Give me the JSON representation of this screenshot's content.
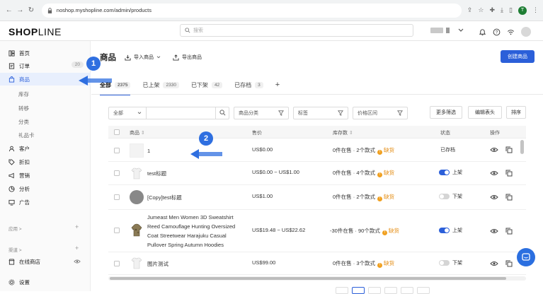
{
  "browser": {
    "url": "noshop.myshopline.com/admin/products",
    "avatar_letter": "T"
  },
  "header": {
    "logo_bold": "SHOP",
    "logo_thin": "LINE",
    "search_placeholder": "搜索"
  },
  "sidebar": {
    "items": [
      {
        "label": "首页",
        "icon": "home-icon"
      },
      {
        "label": "订单",
        "icon": "order-icon",
        "badge": "20"
      },
      {
        "label": "商品",
        "icon": "bag-icon"
      },
      {
        "label": "客户",
        "icon": "user-icon"
      },
      {
        "label": "折扣",
        "icon": "tag-icon"
      },
      {
        "label": "营销",
        "icon": "megaphone-icon"
      },
      {
        "label": "分析",
        "icon": "chart-icon"
      },
      {
        "label": "广告",
        "icon": "monitor-icon"
      }
    ],
    "sub_items": [
      "库存",
      "转移",
      "分类",
      "礼品卡"
    ],
    "group_apps": "应用 >",
    "group_channels": "渠道 >",
    "channel_store": "在线商店",
    "settings": "设置"
  },
  "main": {
    "title": "商品",
    "import_label": "导入商品",
    "export_label": "导出商品",
    "create_label": "创建商品",
    "tabs": [
      {
        "label": "全部",
        "count": "2375"
      },
      {
        "label": "已上架",
        "count": "2330"
      },
      {
        "label": "已下架",
        "count": "42"
      },
      {
        "label": "已存档",
        "count": "3"
      }
    ],
    "tab_add": "+",
    "filters": {
      "scope": "全部",
      "category": "商品分类",
      "tags": "标签",
      "price_range": "价格区间",
      "more": "更多筛选",
      "edit_columns": "编辑表头",
      "sort": "排序"
    },
    "columns": {
      "product": "商品",
      "price": "售价",
      "inventory": "库存数",
      "status": "状态",
      "actions": "操作"
    },
    "rows": [
      {
        "name": "1",
        "price": "US$0.00",
        "inventory": "0件在售 · 2个款式",
        "warn": "缺货",
        "status": "已存档",
        "toggle": "none"
      },
      {
        "name": "test标题",
        "price": "US$0.00 ~ US$1.00",
        "inventory": "0件在售 · 4个款式",
        "warn": "缺货",
        "status": "上架",
        "toggle": "on"
      },
      {
        "name": "[Copy]test标题",
        "price": "US$1.00",
        "inventory": "0件在售 · 2个款式",
        "warn": "缺货",
        "status": "下架",
        "toggle": "off"
      },
      {
        "name_lines": [
          "Jumeast Men Women 3D Sweatshirt",
          "Reed Camouflage Hunting Oversized",
          "Coat Streetwear Harajuku Casual",
          "Pullover Spring Autumn Hoodies"
        ],
        "price": "US$19.48 ~ US$22.62",
        "inventory": "-30件在售 · 90个款式",
        "warn": "缺货",
        "status": "上架",
        "toggle": "on"
      },
      {
        "name": "图片测试",
        "price": "US$99.00",
        "inventory": "0件在售 · 3个款式",
        "warn": "缺货",
        "status": "下架",
        "toggle": "off"
      }
    ]
  },
  "annotations": {
    "step1": "1",
    "step2": "2",
    "accent_color": "#2f6fe0"
  }
}
